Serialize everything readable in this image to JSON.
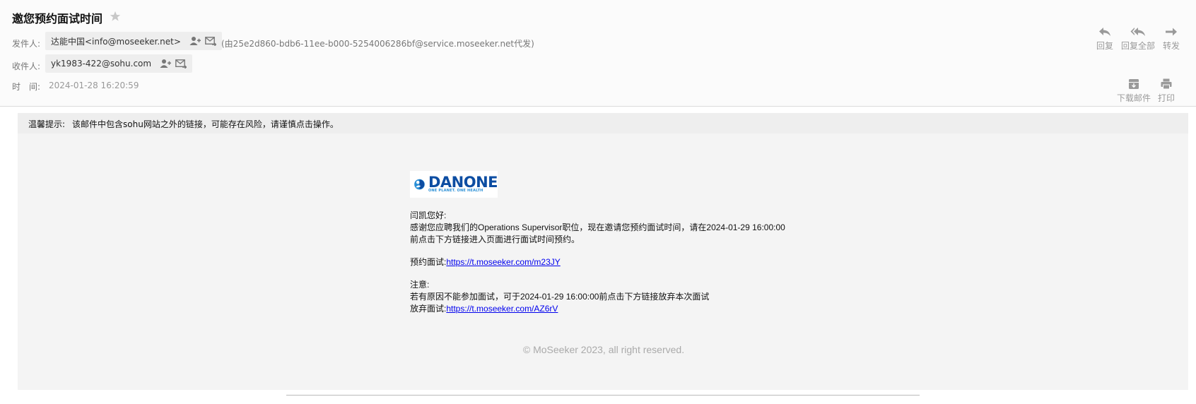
{
  "email": {
    "subject": "邀您预约面试时间",
    "from_label": "发件人:",
    "from_value": "达能中国<info@moseeker.net>",
    "via_note": "(由25e2d860-bdb6-11ee-b000-5254006286bf@service.moseeker.net代发)",
    "to_label": "收件人:",
    "to_value": "yk1983-422@sohu.com",
    "time_label": "时　间:",
    "time_value": "2024-01-28 16:20:59"
  },
  "actions": {
    "reply": "回复",
    "reply_all": "回复全部",
    "forward": "转发",
    "download": "下载邮件",
    "print": "打印"
  },
  "warning": {
    "title": "温馨提示:",
    "text": "该邮件中包含sohu网站之外的链接，可能存在风险，请谨慎点击操作。"
  },
  "logo": {
    "word": "DANONE",
    "tagline": "ONE PLANET. ONE HEALTH",
    "brand_color": "#0c4da2",
    "accent_color": "#2a8fd6"
  },
  "body": {
    "greeting": "闫凯您好:",
    "line1": "感谢您应聘我们的Operations Supervisor职位，现在邀请您预约面试时间，请在2024-01-29 16:00:00",
    "line2": "前点击下方链接进入页面进行面试时间预约。",
    "book_label": "预约面试:",
    "book_link": "https://t.moseeker.com/m23JY",
    "note_label": "注意:",
    "note_text": "若有原因不能参加面试，可于2024-01-29 16:00:00前点击下方链接放弃本次面试",
    "abandon_label": "放弃面试:",
    "abandon_link": "https://t.moseeker.com/AZ6rV",
    "copyright": "© MoSeeker 2023, all right reserved."
  }
}
